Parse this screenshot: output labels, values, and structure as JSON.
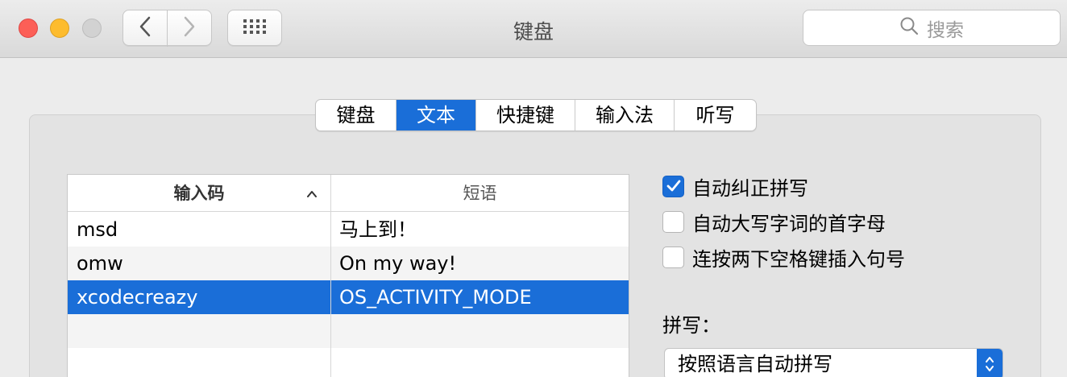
{
  "window": {
    "title": "键盘"
  },
  "search": {
    "placeholder": "搜索"
  },
  "tabs": [
    {
      "label": "键盘",
      "active": false
    },
    {
      "label": "文本",
      "active": true
    },
    {
      "label": "快捷键",
      "active": false
    },
    {
      "label": "输入法",
      "active": false
    },
    {
      "label": "听写",
      "active": false
    }
  ],
  "table": {
    "headers": {
      "code": "输入码",
      "phrase": "短语"
    },
    "rows": [
      {
        "code": "msd",
        "phrase": "马上到！"
      },
      {
        "code": "omw",
        "phrase": "On my way!"
      },
      {
        "code": "xcodecreazy",
        "phrase": "OS_ACTIVITY_MODE",
        "selected": true
      }
    ]
  },
  "options": [
    {
      "label": "自动纠正拼写",
      "checked": true
    },
    {
      "label": "自动大写字词的首字母",
      "checked": false
    },
    {
      "label": "连按两下空格键插入句号",
      "checked": false
    }
  ],
  "spelling": {
    "label": "拼写：",
    "selected": "按照语言自动拼写"
  },
  "colors": {
    "accent": "#1a6ed8",
    "close": "#fc5f57",
    "minimize": "#fdbc2e",
    "zoom": "#d2d2d2"
  }
}
